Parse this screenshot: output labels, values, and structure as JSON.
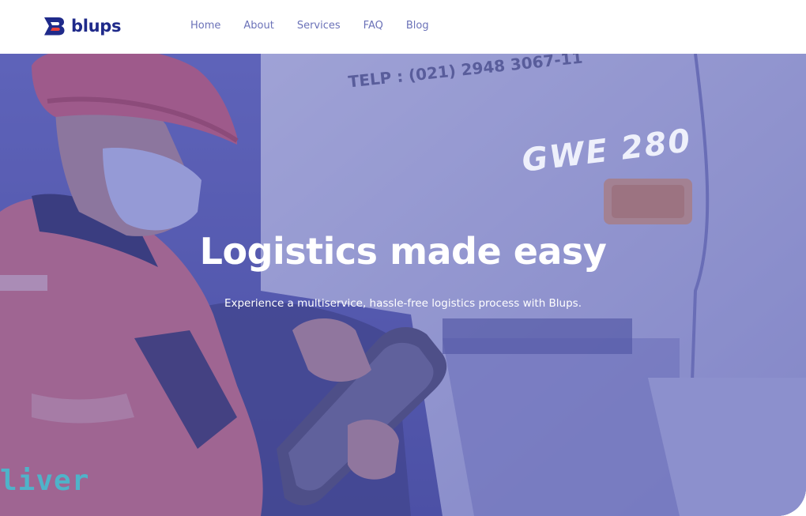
{
  "brand": {
    "name": "blups",
    "color": "#1f2a8a"
  },
  "nav": {
    "items": [
      {
        "label": "Home"
      },
      {
        "label": "About"
      },
      {
        "label": "Services"
      },
      {
        "label": "FAQ"
      },
      {
        "label": "Blog"
      }
    ],
    "link_color": "#6b72b8"
  },
  "hero": {
    "title": "Logistics made easy",
    "subtitle": "Experience a multiservice, hassle-free logistics process with Blups.",
    "overlay_color": "#4e54b2",
    "photo": {
      "truck_phone": "TELP : (021) 2948 3067-11",
      "truck_model": "GWE 280",
      "jacket_text": "liver"
    }
  }
}
